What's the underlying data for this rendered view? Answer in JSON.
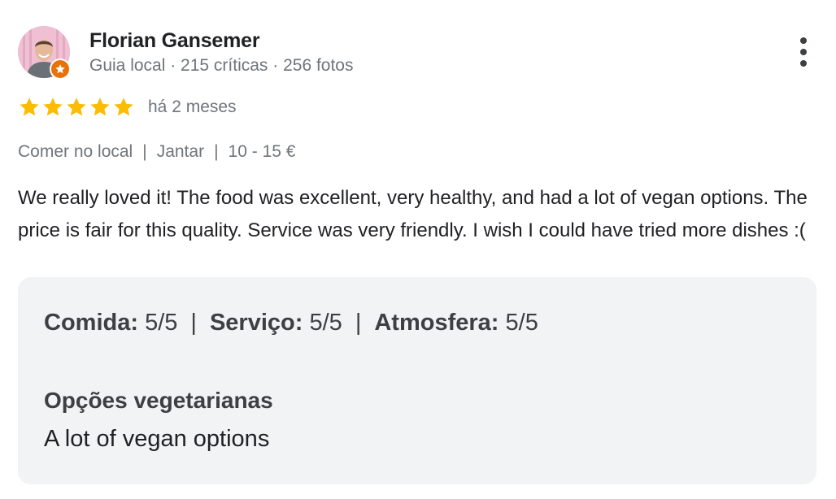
{
  "reviewer": {
    "name": "Florian Gansemer",
    "meta": "Guia local · 215 críticas · 256 fotos"
  },
  "rating": {
    "stars": 5,
    "max_stars": 5,
    "date": "há 2 meses"
  },
  "tags": [
    "Comer no local",
    "Jantar",
    "10 - 15 €"
  ],
  "tag_separator": "|",
  "review_text": "We really loved it! The food was excellent, very healthy, and had a lot of vegan options. The price is fair for this quality. Service was very friendly. I wish I could have tried more dishes :(",
  "scores": [
    {
      "label": "Comida",
      "value": "5/5"
    },
    {
      "label": "Serviço",
      "value": "5/5"
    },
    {
      "label": "Atmosfera",
      "value": "5/5"
    }
  ],
  "attribute": {
    "title": "Opções vegetarianas",
    "value": "A lot of vegan options"
  },
  "colors": {
    "star": "#fbbc04",
    "badge": "#e8710a",
    "muted_text": "#70757a",
    "box_background": "#f1f3f4"
  },
  "icons": {
    "more": "more-vert-icon",
    "badge": "local-guide-star-icon",
    "star": "star-icon"
  }
}
